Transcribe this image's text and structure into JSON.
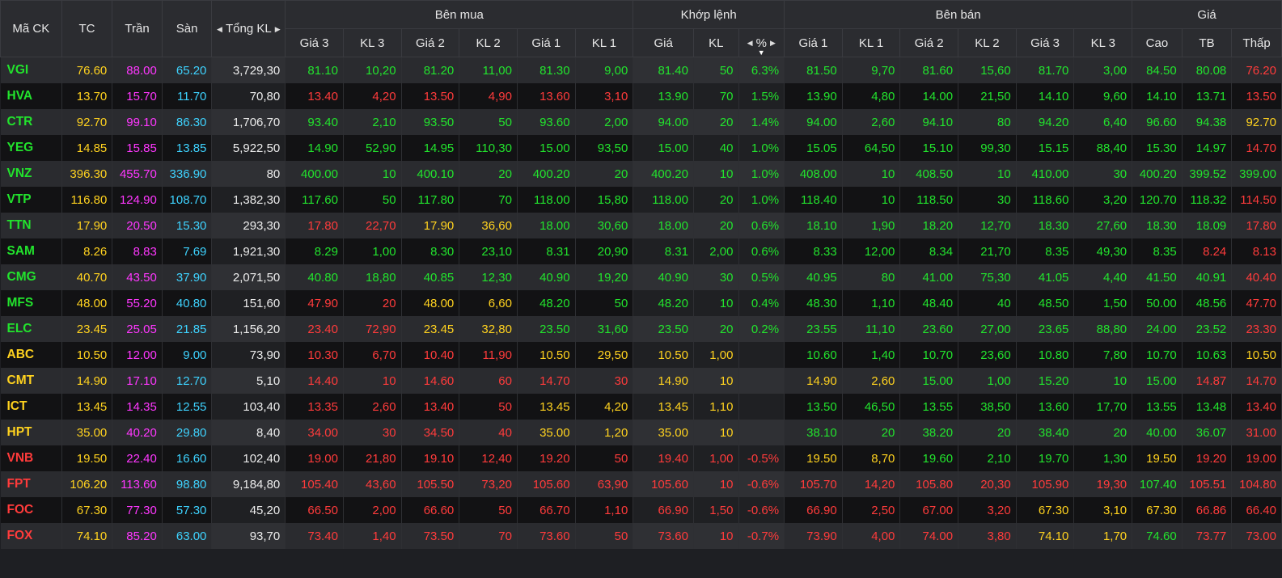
{
  "colors": {
    "up": "#22e32d",
    "down": "#ff3b3b",
    "ref": "#ffd21f",
    "ceil": "#ff37ff",
    "floor": "#3ed3ff"
  },
  "header": {
    "symbol": "Mã CK",
    "ref": "TC",
    "ceil": "Trần",
    "floor": "Sàn",
    "total_vol": "Tổng KL",
    "bid_group": "Bên mua",
    "match_group": "Khớp lệnh",
    "ask_group": "Bên bán",
    "price_group": "Giá",
    "bid_cols": [
      "Giá 3",
      "KL 3",
      "Giá 2",
      "KL 2",
      "Giá 1",
      "KL 1"
    ],
    "match_cols": [
      "Giá",
      "KL",
      "%"
    ],
    "ask_cols": [
      "Giá 1",
      "KL 1",
      "Giá 2",
      "KL 2",
      "Giá 3",
      "KL 3"
    ],
    "price_cols": [
      "Cao",
      "TB",
      "Thấp"
    ]
  },
  "rows": [
    {
      "v": [
        "VGI",
        "76.60",
        "88.00",
        "65.20",
        "3,729,30",
        "81.10",
        "10,20",
        "81.20",
        "11,00",
        "81.30",
        "9,00",
        "81.40",
        "50",
        "6.3%",
        "81.50",
        "9,70",
        "81.60",
        "15,60",
        "81.70",
        "3,00",
        "84.50",
        "80.08",
        "76.20"
      ],
      "c": [
        "g",
        "y",
        "p",
        "c",
        "w",
        "g",
        "g",
        "g",
        "g",
        "g",
        "g",
        "g",
        "g",
        "g",
        "g",
        "g",
        "g",
        "g",
        "g",
        "g",
        "g",
        "g",
        "r"
      ]
    },
    {
      "v": [
        "HVA",
        "13.70",
        "15.70",
        "11.70",
        "70,80",
        "13.40",
        "4,20",
        "13.50",
        "4,90",
        "13.60",
        "3,10",
        "13.90",
        "70",
        "1.5%",
        "13.90",
        "4,80",
        "14.00",
        "21,50",
        "14.10",
        "9,60",
        "14.10",
        "13.71",
        "13.50"
      ],
      "c": [
        "g",
        "y",
        "p",
        "c",
        "w",
        "r",
        "r",
        "r",
        "r",
        "r",
        "r",
        "g",
        "g",
        "g",
        "g",
        "g",
        "g",
        "g",
        "g",
        "g",
        "g",
        "g",
        "r"
      ]
    },
    {
      "v": [
        "CTR",
        "92.70",
        "99.10",
        "86.30",
        "1,706,70",
        "93.40",
        "2,10",
        "93.50",
        "50",
        "93.60",
        "2,00",
        "94.00",
        "20",
        "1.4%",
        "94.00",
        "2,60",
        "94.10",
        "80",
        "94.20",
        "6,40",
        "96.60",
        "94.38",
        "92.70"
      ],
      "c": [
        "g",
        "y",
        "p",
        "c",
        "w",
        "g",
        "g",
        "g",
        "g",
        "g",
        "g",
        "g",
        "g",
        "g",
        "g",
        "g",
        "g",
        "g",
        "g",
        "g",
        "g",
        "g",
        "y"
      ]
    },
    {
      "v": [
        "YEG",
        "14.85",
        "15.85",
        "13.85",
        "5,922,50",
        "14.90",
        "52,90",
        "14.95",
        "110,30",
        "15.00",
        "93,50",
        "15.00",
        "40",
        "1.0%",
        "15.05",
        "64,50",
        "15.10",
        "99,30",
        "15.15",
        "88,40",
        "15.30",
        "14.97",
        "14.70"
      ],
      "c": [
        "g",
        "y",
        "p",
        "c",
        "w",
        "g",
        "g",
        "g",
        "g",
        "g",
        "g",
        "g",
        "g",
        "g",
        "g",
        "g",
        "g",
        "g",
        "g",
        "g",
        "g",
        "g",
        "r"
      ]
    },
    {
      "v": [
        "VNZ",
        "396.30",
        "455.70",
        "336.90",
        "80",
        "400.00",
        "10",
        "400.10",
        "20",
        "400.20",
        "20",
        "400.20",
        "10",
        "1.0%",
        "408.00",
        "10",
        "408.50",
        "10",
        "410.00",
        "30",
        "400.20",
        "399.52",
        "399.00"
      ],
      "c": [
        "g",
        "y",
        "p",
        "c",
        "w",
        "g",
        "g",
        "g",
        "g",
        "g",
        "g",
        "g",
        "g",
        "g",
        "g",
        "g",
        "g",
        "g",
        "g",
        "g",
        "g",
        "g",
        "g"
      ]
    },
    {
      "v": [
        "VTP",
        "116.80",
        "124.90",
        "108.70",
        "1,382,30",
        "117.60",
        "50",
        "117.80",
        "70",
        "118.00",
        "15,80",
        "118.00",
        "20",
        "1.0%",
        "118.40",
        "10",
        "118.50",
        "30",
        "118.60",
        "3,20",
        "120.70",
        "118.32",
        "114.50"
      ],
      "c": [
        "g",
        "y",
        "p",
        "c",
        "w",
        "g",
        "g",
        "g",
        "g",
        "g",
        "g",
        "g",
        "g",
        "g",
        "g",
        "g",
        "g",
        "g",
        "g",
        "g",
        "g",
        "g",
        "r"
      ]
    },
    {
      "v": [
        "TTN",
        "17.90",
        "20.50",
        "15.30",
        "293,30",
        "17.80",
        "22,70",
        "17.90",
        "36,60",
        "18.00",
        "30,60",
        "18.00",
        "20",
        "0.6%",
        "18.10",
        "1,90",
        "18.20",
        "12,70",
        "18.30",
        "27,60",
        "18.30",
        "18.09",
        "17.80"
      ],
      "c": [
        "g",
        "y",
        "p",
        "c",
        "w",
        "r",
        "r",
        "y",
        "y",
        "g",
        "g",
        "g",
        "g",
        "g",
        "g",
        "g",
        "g",
        "g",
        "g",
        "g",
        "g",
        "g",
        "r"
      ]
    },
    {
      "v": [
        "SAM",
        "8.26",
        "8.83",
        "7.69",
        "1,921,30",
        "8.29",
        "1,00",
        "8.30",
        "23,10",
        "8.31",
        "20,90",
        "8.31",
        "2,00",
        "0.6%",
        "8.33",
        "12,00",
        "8.34",
        "21,70",
        "8.35",
        "49,30",
        "8.35",
        "8.24",
        "8.13"
      ],
      "c": [
        "g",
        "y",
        "p",
        "c",
        "w",
        "g",
        "g",
        "g",
        "g",
        "g",
        "g",
        "g",
        "g",
        "g",
        "g",
        "g",
        "g",
        "g",
        "g",
        "g",
        "g",
        "r",
        "r"
      ]
    },
    {
      "v": [
        "CMG",
        "40.70",
        "43.50",
        "37.90",
        "2,071,50",
        "40.80",
        "18,80",
        "40.85",
        "12,30",
        "40.90",
        "19,20",
        "40.90",
        "30",
        "0.5%",
        "40.95",
        "80",
        "41.00",
        "75,30",
        "41.05",
        "4,40",
        "41.50",
        "40.91",
        "40.40"
      ],
      "c": [
        "g",
        "y",
        "p",
        "c",
        "w",
        "g",
        "g",
        "g",
        "g",
        "g",
        "g",
        "g",
        "g",
        "g",
        "g",
        "g",
        "g",
        "g",
        "g",
        "g",
        "g",
        "g",
        "r"
      ]
    },
    {
      "v": [
        "MFS",
        "48.00",
        "55.20",
        "40.80",
        "151,60",
        "47.90",
        "20",
        "48.00",
        "6,60",
        "48.20",
        "50",
        "48.20",
        "10",
        "0.4%",
        "48.30",
        "1,10",
        "48.40",
        "40",
        "48.50",
        "1,50",
        "50.00",
        "48.56",
        "47.70"
      ],
      "c": [
        "g",
        "y",
        "p",
        "c",
        "w",
        "r",
        "r",
        "y",
        "y",
        "g",
        "g",
        "g",
        "g",
        "g",
        "g",
        "g",
        "g",
        "g",
        "g",
        "g",
        "g",
        "g",
        "r"
      ]
    },
    {
      "v": [
        "ELC",
        "23.45",
        "25.05",
        "21.85",
        "1,156,20",
        "23.40",
        "72,90",
        "23.45",
        "32,80",
        "23.50",
        "31,60",
        "23.50",
        "20",
        "0.2%",
        "23.55",
        "11,10",
        "23.60",
        "27,00",
        "23.65",
        "88,80",
        "24.00",
        "23.52",
        "23.30"
      ],
      "c": [
        "g",
        "y",
        "p",
        "c",
        "w",
        "r",
        "r",
        "y",
        "y",
        "g",
        "g",
        "g",
        "g",
        "g",
        "g",
        "g",
        "g",
        "g",
        "g",
        "g",
        "g",
        "g",
        "r"
      ]
    },
    {
      "v": [
        "ABC",
        "10.50",
        "12.00",
        "9.00",
        "73,90",
        "10.30",
        "6,70",
        "10.40",
        "11,90",
        "10.50",
        "29,50",
        "10.50",
        "1,00",
        "",
        "10.60",
        "1,40",
        "10.70",
        "23,60",
        "10.80",
        "7,80",
        "10.70",
        "10.63",
        "10.50"
      ],
      "c": [
        "y",
        "y",
        "p",
        "c",
        "w",
        "r",
        "r",
        "r",
        "r",
        "y",
        "y",
        "y",
        "y",
        "y",
        "g",
        "g",
        "g",
        "g",
        "g",
        "g",
        "g",
        "g",
        "y"
      ]
    },
    {
      "v": [
        "CMT",
        "14.90",
        "17.10",
        "12.70",
        "5,10",
        "14.40",
        "10",
        "14.60",
        "60",
        "14.70",
        "30",
        "14.90",
        "10",
        "",
        "14.90",
        "2,60",
        "15.00",
        "1,00",
        "15.20",
        "10",
        "15.00",
        "14.87",
        "14.70"
      ],
      "c": [
        "y",
        "y",
        "p",
        "c",
        "w",
        "r",
        "r",
        "r",
        "r",
        "r",
        "r",
        "y",
        "y",
        "y",
        "y",
        "y",
        "g",
        "g",
        "g",
        "g",
        "g",
        "r",
        "r"
      ]
    },
    {
      "v": [
        "ICT",
        "13.45",
        "14.35",
        "12.55",
        "103,40",
        "13.35",
        "2,60",
        "13.40",
        "50",
        "13.45",
        "4,20",
        "13.45",
        "1,10",
        "",
        "13.50",
        "46,50",
        "13.55",
        "38,50",
        "13.60",
        "17,70",
        "13.55",
        "13.48",
        "13.40"
      ],
      "c": [
        "y",
        "y",
        "p",
        "c",
        "w",
        "r",
        "r",
        "r",
        "r",
        "y",
        "y",
        "y",
        "y",
        "y",
        "g",
        "g",
        "g",
        "g",
        "g",
        "g",
        "g",
        "g",
        "r"
      ]
    },
    {
      "v": [
        "HPT",
        "35.00",
        "40.20",
        "29.80",
        "8,40",
        "34.00",
        "30",
        "34.50",
        "40",
        "35.00",
        "1,20",
        "35.00",
        "10",
        "",
        "38.10",
        "20",
        "38.20",
        "20",
        "38.40",
        "20",
        "40.00",
        "36.07",
        "31.00"
      ],
      "c": [
        "y",
        "y",
        "p",
        "c",
        "w",
        "r",
        "r",
        "r",
        "r",
        "y",
        "y",
        "y",
        "y",
        "y",
        "g",
        "g",
        "g",
        "g",
        "g",
        "g",
        "g",
        "g",
        "r"
      ]
    },
    {
      "v": [
        "VNB",
        "19.50",
        "22.40",
        "16.60",
        "102,40",
        "19.00",
        "21,80",
        "19.10",
        "12,40",
        "19.20",
        "50",
        "19.40",
        "1,00",
        "-0.5%",
        "19.50",
        "8,70",
        "19.60",
        "2,10",
        "19.70",
        "1,30",
        "19.50",
        "19.20",
        "19.00"
      ],
      "c": [
        "r",
        "y",
        "p",
        "c",
        "w",
        "r",
        "r",
        "r",
        "r",
        "r",
        "r",
        "r",
        "r",
        "r",
        "y",
        "y",
        "g",
        "g",
        "g",
        "g",
        "y",
        "r",
        "r"
      ]
    },
    {
      "v": [
        "FPT",
        "106.20",
        "113.60",
        "98.80",
        "9,184,80",
        "105.40",
        "43,60",
        "105.50",
        "73,20",
        "105.60",
        "63,90",
        "105.60",
        "10",
        "-0.6%",
        "105.70",
        "14,20",
        "105.80",
        "20,30",
        "105.90",
        "19,30",
        "107.40",
        "105.51",
        "104.80"
      ],
      "c": [
        "r",
        "y",
        "p",
        "c",
        "w",
        "r",
        "r",
        "r",
        "r",
        "r",
        "r",
        "r",
        "r",
        "r",
        "r",
        "r",
        "r",
        "r",
        "r",
        "r",
        "g",
        "r",
        "r"
      ]
    },
    {
      "v": [
        "FOC",
        "67.30",
        "77.30",
        "57.30",
        "45,20",
        "66.50",
        "2,00",
        "66.60",
        "50",
        "66.70",
        "1,10",
        "66.90",
        "1,50",
        "-0.6%",
        "66.90",
        "2,50",
        "67.00",
        "3,20",
        "67.30",
        "3,10",
        "67.30",
        "66.86",
        "66.40"
      ],
      "c": [
        "r",
        "y",
        "p",
        "c",
        "w",
        "r",
        "r",
        "r",
        "r",
        "r",
        "r",
        "r",
        "r",
        "r",
        "r",
        "r",
        "r",
        "r",
        "y",
        "y",
        "y",
        "r",
        "r"
      ]
    },
    {
      "v": [
        "FOX",
        "74.10",
        "85.20",
        "63.00",
        "93,70",
        "73.40",
        "1,40",
        "73.50",
        "70",
        "73.60",
        "50",
        "73.60",
        "10",
        "-0.7%",
        "73.90",
        "4,00",
        "74.00",
        "3,80",
        "74.10",
        "1,70",
        "74.60",
        "73.77",
        "73.00"
      ],
      "c": [
        "r",
        "y",
        "p",
        "c",
        "w",
        "r",
        "r",
        "r",
        "r",
        "r",
        "r",
        "r",
        "r",
        "r",
        "r",
        "r",
        "r",
        "r",
        "y",
        "y",
        "g",
        "r",
        "r"
      ]
    }
  ]
}
